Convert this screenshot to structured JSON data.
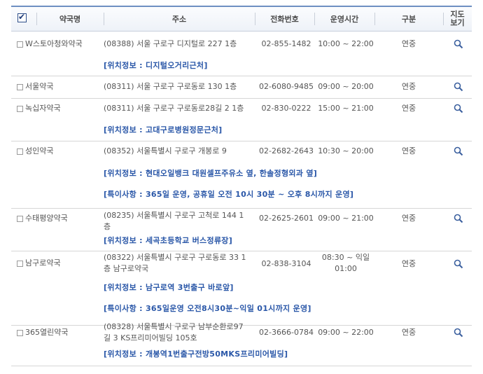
{
  "header": {
    "check_all": "",
    "name": "약국명",
    "addr": "주소",
    "tel": "전화번호",
    "hours": "운영시간",
    "type": "구분",
    "map_l1": "지도",
    "map_l2": "보기"
  },
  "rows": [
    {
      "name": "W스토아청와약국",
      "addr1": "(08388) 서울 구로구 디지털로 227 1층",
      "addr2": "",
      "tel": "02-855-1482",
      "hours1": "10:00 ~ 22:00",
      "hours2": "",
      "type": "연중",
      "info1": "[위치정보 : 디지털오거리근처]",
      "info2": ""
    },
    {
      "name": "서울약국",
      "addr1": "(08311) 서울 구로구 구로동로 130 1층",
      "addr2": "",
      "tel": "02-6080-9485",
      "hours1": "09:00 ~ 20:00",
      "hours2": "",
      "type": "연중",
      "info1": "",
      "info2": ""
    },
    {
      "name": "녹십자약국",
      "addr1": "(08311) 서울 구로구 구로동로28길 2 1층",
      "addr2": "",
      "tel": "02-830-0222",
      "hours1": "15:00 ~ 21:00",
      "hours2": "",
      "type": "연중",
      "info1": "[위치정보 : 고대구로병원정문근처]",
      "info2": ""
    },
    {
      "name": "성인약국",
      "addr1": "(08352) 서울특별시 구로구 개봉로 9",
      "addr2": "",
      "tel": "02-2682-2643",
      "hours1": "10:30 ~ 20:00",
      "hours2": "",
      "type": "연중",
      "info1": "[위치정보 : 현대오일뱅크 대원셀프주유소 옆, 한솔정형외과 옆]",
      "info2": "[특이사항 : 365일 운영, 공휴일 오전 10시 30분 ~ 오후 8시까지 운영]"
    },
    {
      "name": "수태평양약국",
      "addr1": "(08235) 서울특별시 구로구 고척로 144 1",
      "addr2": "층",
      "tel": "02-2625-2601",
      "hours1": "09:00 ~ 21:00",
      "hours2": "",
      "type": "연중",
      "info1": "[위치정보 : 세곡초등학교 버스정류장]",
      "info2": ""
    },
    {
      "name": "남구로약국",
      "addr1": "(08322) 서울특별시 구로구 구로동로 33 1",
      "addr2": "층 남구로약국",
      "tel": "02-838-3104",
      "hours1": "08:30 ~ 익일",
      "hours2": "01:00",
      "type": "연중",
      "info1": "[위치정보 : 남구로역 3번출구 바로앞]",
      "info2": "[특이사항 : 365일운영 오전8시30분~익일 01시까지 운영]"
    },
    {
      "name": "365열린약국",
      "addr1": "(08328) 서울특별시 구로구 남부순환로97",
      "addr2": "길 3 KS프리미어빌딩 105호",
      "tel": "02-3666-0784",
      "hours1": "09:00 ~ 22:00",
      "hours2": "",
      "type": "연중",
      "info1": "[위치정보 : 개봉역1번출구전방50MKS프리미어빌딩]",
      "info2": ""
    }
  ]
}
